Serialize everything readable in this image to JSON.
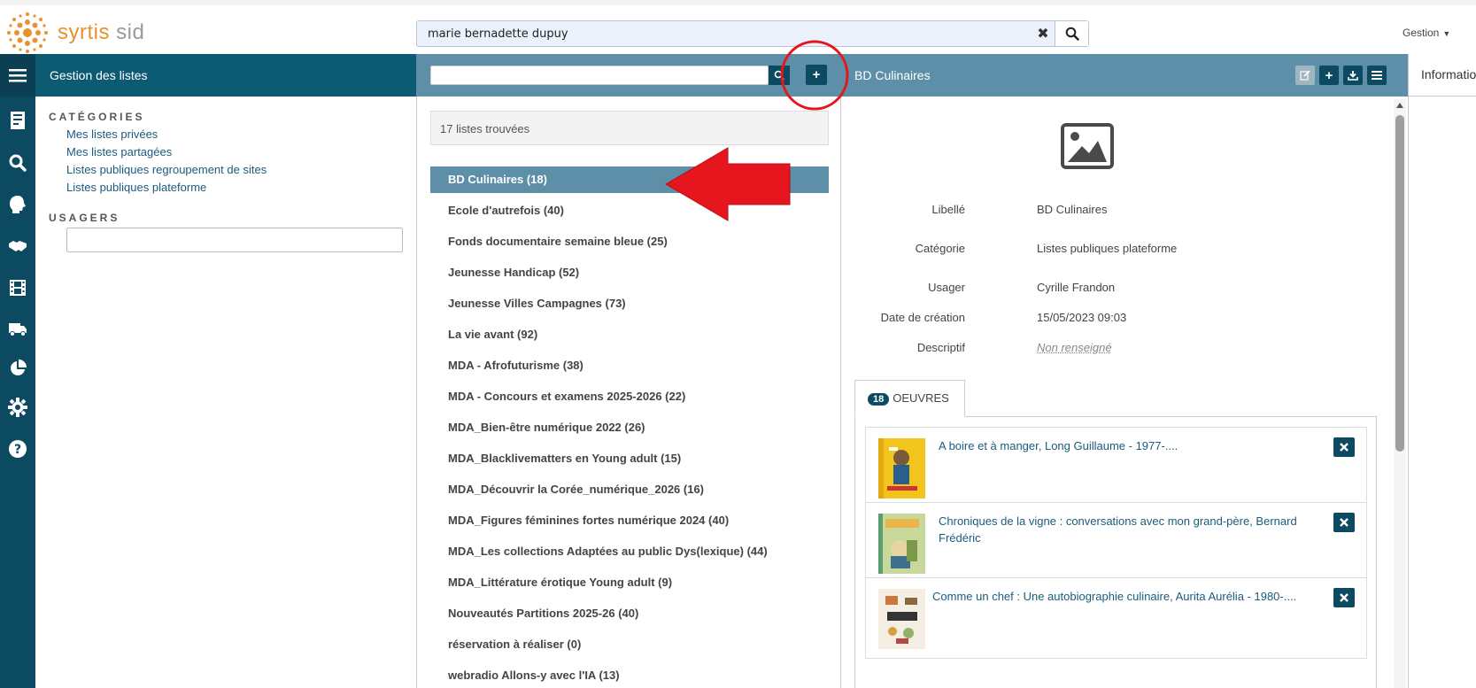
{
  "app": {
    "logo_main": "syrtis",
    "logo_sub": " sid"
  },
  "search": {
    "query": "marie bernadette dupuy"
  },
  "user_menu": {
    "label": "Gestion"
  },
  "panels": {
    "lists_title": "Gestion des listes",
    "detail_title": "BD Culinaires",
    "info_tab": "Informations"
  },
  "categories": {
    "heading": "CATÉGORIES",
    "links": [
      "Mes listes privées",
      "Mes listes partagées",
      "Listes publiques regroupement de sites",
      "Listes publiques plateforme"
    ]
  },
  "usagers": {
    "heading": "USAGERS",
    "value": ""
  },
  "lists": {
    "count_text": "17 listes trouvées",
    "items": [
      "BD Culinaires (18)",
      "Ecole d'autrefois (40)",
      "Fonds documentaire semaine bleue (25)",
      "Jeunesse Handicap (52)",
      "Jeunesse Villes Campagnes (73)",
      "La vie avant (92)",
      "MDA - Afrofuturisme (38)",
      "MDA - Concours et examens 2025-2026 (22)",
      "MDA_Bien-être numérique 2022 (26)",
      "MDA_Blacklivematters en Young adult (15)",
      "MDA_Découvrir la Corée_numérique_2026 (16)",
      "MDA_Figures féminines fortes numérique 2024 (40)",
      "MDA_Les collections Adaptées au public Dys(lexique) (44)",
      "MDA_Littérature érotique Young adult (9)",
      "Nouveautés Partitions 2025-26 (40)",
      "réservation à réaliser (0)",
      "webradio Allons-y avec l'IA (13)"
    ]
  },
  "detail": {
    "fields": [
      {
        "label": "Libellé",
        "value": "BD Culinaires"
      },
      {
        "label": "Catégorie",
        "value": "Listes publiques plateforme"
      },
      {
        "label": "Usager",
        "value": "Cyrille Frandon"
      },
      {
        "label": "Date de création",
        "value": "15/05/2023 09:03"
      },
      {
        "label": "Descriptif",
        "value": "Non renseigné"
      }
    ],
    "works_count": "18",
    "works_tab": "OEUVRES",
    "works": [
      "A boire et à manger, Long Guillaume - 1977-....",
      "Chroniques de la vigne : conversations avec mon grand-père, Bernard Frédéric",
      "Comme un chef : Une autobiographie culinaire, Aurita Aurélia - 1980-...."
    ]
  },
  "colors": {
    "nav": "#0c4a62",
    "header_dark": "#0d5a73",
    "header_light": "#5e8fa8",
    "accent": "#e8912e",
    "annotation": "#e5161e"
  }
}
